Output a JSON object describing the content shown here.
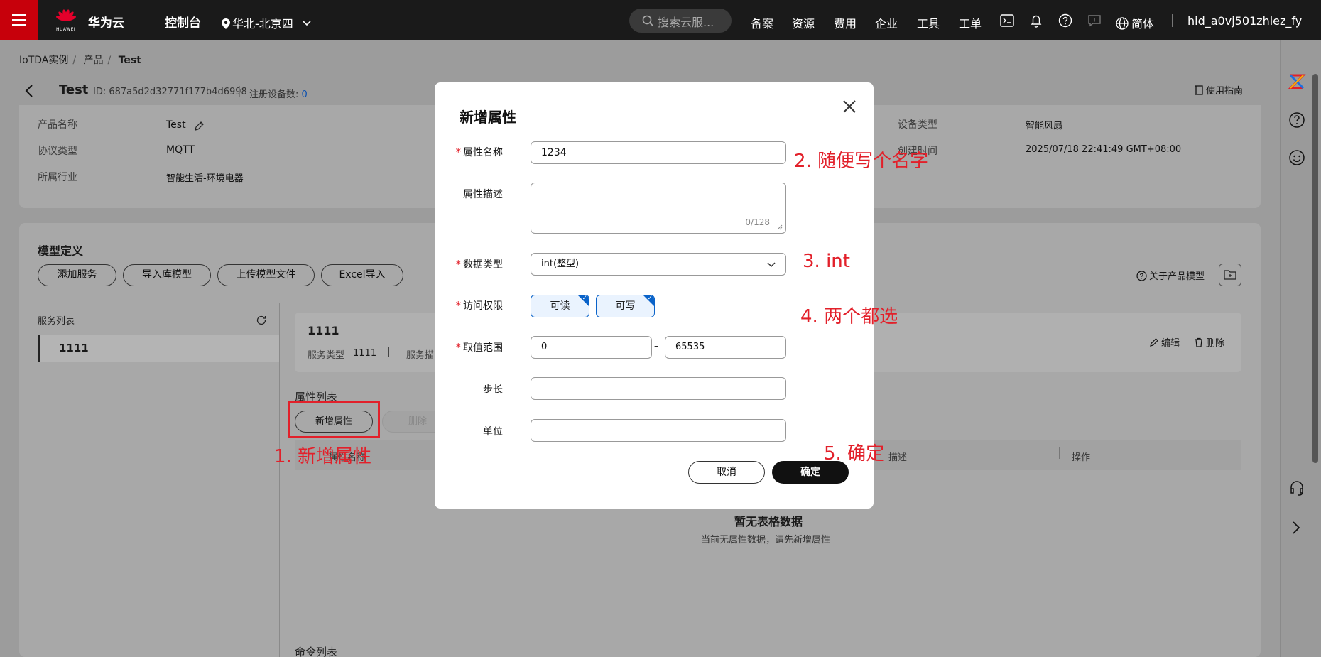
{
  "topbar": {
    "brand": "华为云",
    "logo_text": "HUAWEI",
    "console": "控制台",
    "region": "华北-北京四",
    "search_placeholder": "搜索云服...",
    "nav": [
      "备案",
      "资源",
      "费用",
      "企业",
      "工具",
      "工单"
    ],
    "language": "简体",
    "user": "hid_a0vj501zhlez_fy"
  },
  "breadcrumb": [
    "IoTDA实例",
    "产品",
    "Test"
  ],
  "product": {
    "name": "Test",
    "id_text": "ID: 687a5d2d32771f177b4d6998",
    "registered_label": "注册设备数:",
    "registered_count": "0",
    "guide": "使用指南"
  },
  "info": {
    "name_label": "产品名称",
    "name_value": "Test",
    "protocol_label": "协议类型",
    "protocol_value": "MQTT",
    "industry_label": "所属行业",
    "industry_value": "智能生活-环境电器",
    "device_type_label": "设备类型",
    "device_type_value": "智能风扇",
    "created_label": "创建时间",
    "created_value": "2025/07/18 22:41:49 GMT+08:00"
  },
  "model": {
    "title": "模型定义",
    "buttons": [
      "添加服务",
      "导入库模型",
      "上传模型文件",
      "Excel导入"
    ],
    "about": "关于产品模型",
    "service_list_label": "服务列表",
    "service_item": "1111",
    "service_card_title": "1111",
    "service_type_label": "服务类型",
    "service_type_value": "1111",
    "service_desc_label": "服务描",
    "edit": "编辑",
    "delete": "删除",
    "prop_list_label": "属性列表",
    "add_prop": "新增属性",
    "del_prop": "删除",
    "col_name": "属性名称",
    "col_desc": "描述",
    "col_op": "操作",
    "empty_title": "暂无表格数据",
    "empty_desc": "当前无属性数据，请先新增属性",
    "cmd_list_label": "命令列表"
  },
  "modal": {
    "title": "新增属性",
    "name_label": "属性名称",
    "name_value": "1234",
    "desc_label": "属性描述",
    "desc_counter": "0/128",
    "type_label": "数据类型",
    "type_value": "int(整型)",
    "access_label": "访问权限",
    "access_read": "可读",
    "access_write": "可写",
    "range_label": "取值范围",
    "range_min": "0",
    "range_dash": "–",
    "range_max": "65535",
    "step_label": "步长",
    "unit_label": "单位",
    "cancel": "取消",
    "ok": "确定",
    "required_mark": "*"
  },
  "annotations": {
    "a1": "1. 新增属性",
    "a2": "2. 随便写个名字",
    "a3": "3. int",
    "a4": "4. 两个都选",
    "a5": "5. 确定"
  },
  "colors": {
    "brand_red": "#c7000b",
    "annotation_red": "#e2202a",
    "selected_blue": "#0a63c9"
  }
}
